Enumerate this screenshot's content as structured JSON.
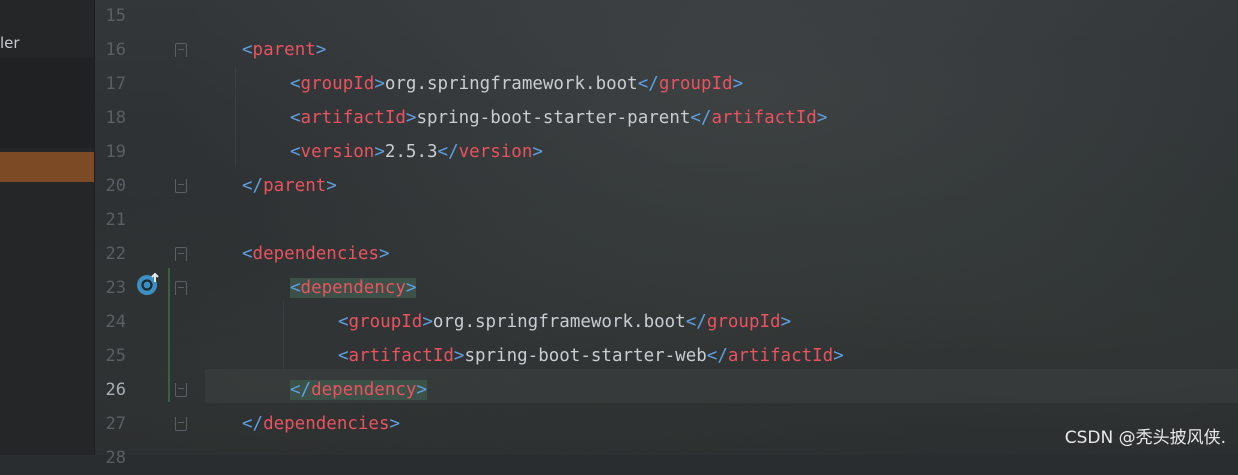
{
  "side_panel": {
    "partial_label": "ler"
  },
  "editor": {
    "current_line": "26",
    "lines": [
      {
        "num": "15",
        "indent": 0,
        "segments": []
      },
      {
        "num": "16",
        "indent": 0,
        "segments": [
          {
            "cls": "b",
            "text": "<"
          },
          {
            "cls": "t",
            "text": "parent"
          },
          {
            "cls": "b",
            "text": ">"
          }
        ]
      },
      {
        "num": "17",
        "indent": 1,
        "segments": [
          {
            "cls": "b",
            "text": "<"
          },
          {
            "cls": "t",
            "text": "groupId"
          },
          {
            "cls": "b",
            "text": ">"
          },
          {
            "cls": "x",
            "text": "org.springframework.boot"
          },
          {
            "cls": "b",
            "text": "</"
          },
          {
            "cls": "t",
            "text": "groupId"
          },
          {
            "cls": "b",
            "text": ">"
          }
        ]
      },
      {
        "num": "18",
        "indent": 1,
        "segments": [
          {
            "cls": "b",
            "text": "<"
          },
          {
            "cls": "t",
            "text": "artifactId"
          },
          {
            "cls": "b",
            "text": ">"
          },
          {
            "cls": "x",
            "text": "spring-boot-starter-parent"
          },
          {
            "cls": "b",
            "text": "</"
          },
          {
            "cls": "t",
            "text": "artifactId"
          },
          {
            "cls": "b",
            "text": ">"
          }
        ]
      },
      {
        "num": "19",
        "indent": 1,
        "segments": [
          {
            "cls": "b",
            "text": "<"
          },
          {
            "cls": "t",
            "text": "version"
          },
          {
            "cls": "b",
            "text": ">"
          },
          {
            "cls": "x",
            "text": "2.5.3"
          },
          {
            "cls": "b",
            "text": "</"
          },
          {
            "cls": "t",
            "text": "version"
          },
          {
            "cls": "b",
            "text": ">"
          }
        ]
      },
      {
        "num": "20",
        "indent": 0,
        "segments": [
          {
            "cls": "b",
            "text": "</"
          },
          {
            "cls": "t",
            "text": "parent"
          },
          {
            "cls": "b",
            "text": ">"
          }
        ]
      },
      {
        "num": "21",
        "indent": 0,
        "segments": []
      },
      {
        "num": "22",
        "indent": 0,
        "segments": [
          {
            "cls": "b",
            "text": "<"
          },
          {
            "cls": "t",
            "text": "dependencies"
          },
          {
            "cls": "b",
            "text": ">"
          }
        ]
      },
      {
        "num": "23",
        "indent": 1,
        "highlight": true,
        "segments": [
          {
            "cls": "b",
            "text": "<"
          },
          {
            "cls": "t",
            "text": "dependency"
          },
          {
            "cls": "b",
            "text": ">"
          }
        ]
      },
      {
        "num": "24",
        "indent": 2,
        "segments": [
          {
            "cls": "b",
            "text": "<"
          },
          {
            "cls": "t",
            "text": "groupId"
          },
          {
            "cls": "b",
            "text": ">"
          },
          {
            "cls": "x",
            "text": "org.springframework.boot"
          },
          {
            "cls": "b",
            "text": "</"
          },
          {
            "cls": "t",
            "text": "groupId"
          },
          {
            "cls": "b",
            "text": ">"
          }
        ]
      },
      {
        "num": "25",
        "indent": 2,
        "segments": [
          {
            "cls": "b",
            "text": "<"
          },
          {
            "cls": "t",
            "text": "artifactId"
          },
          {
            "cls": "b",
            "text": ">"
          },
          {
            "cls": "x",
            "text": "spring-boot-starter-web"
          },
          {
            "cls": "b",
            "text": "</"
          },
          {
            "cls": "t",
            "text": "artifactId"
          },
          {
            "cls": "b",
            "text": ">"
          }
        ]
      },
      {
        "num": "26",
        "indent": 1,
        "highlight": true,
        "segments": [
          {
            "cls": "b",
            "text": "</"
          },
          {
            "cls": "t",
            "text": "dependency"
          },
          {
            "cls": "b",
            "text": ">"
          }
        ]
      },
      {
        "num": "27",
        "indent": 0,
        "segments": [
          {
            "cls": "b",
            "text": "</"
          },
          {
            "cls": "t",
            "text": "dependencies"
          },
          {
            "cls": "b",
            "text": ">"
          }
        ]
      },
      {
        "num": "28",
        "indent": 0,
        "segments": []
      }
    ],
    "gutter_icon": "maven-override-icon"
  },
  "colors": {
    "bracket": "#5f9fe0",
    "tag": "#e8535f",
    "text": "#c8cdd1",
    "match_highlight": "#3c5148"
  },
  "watermark": "CSDN @秃头披风侠."
}
